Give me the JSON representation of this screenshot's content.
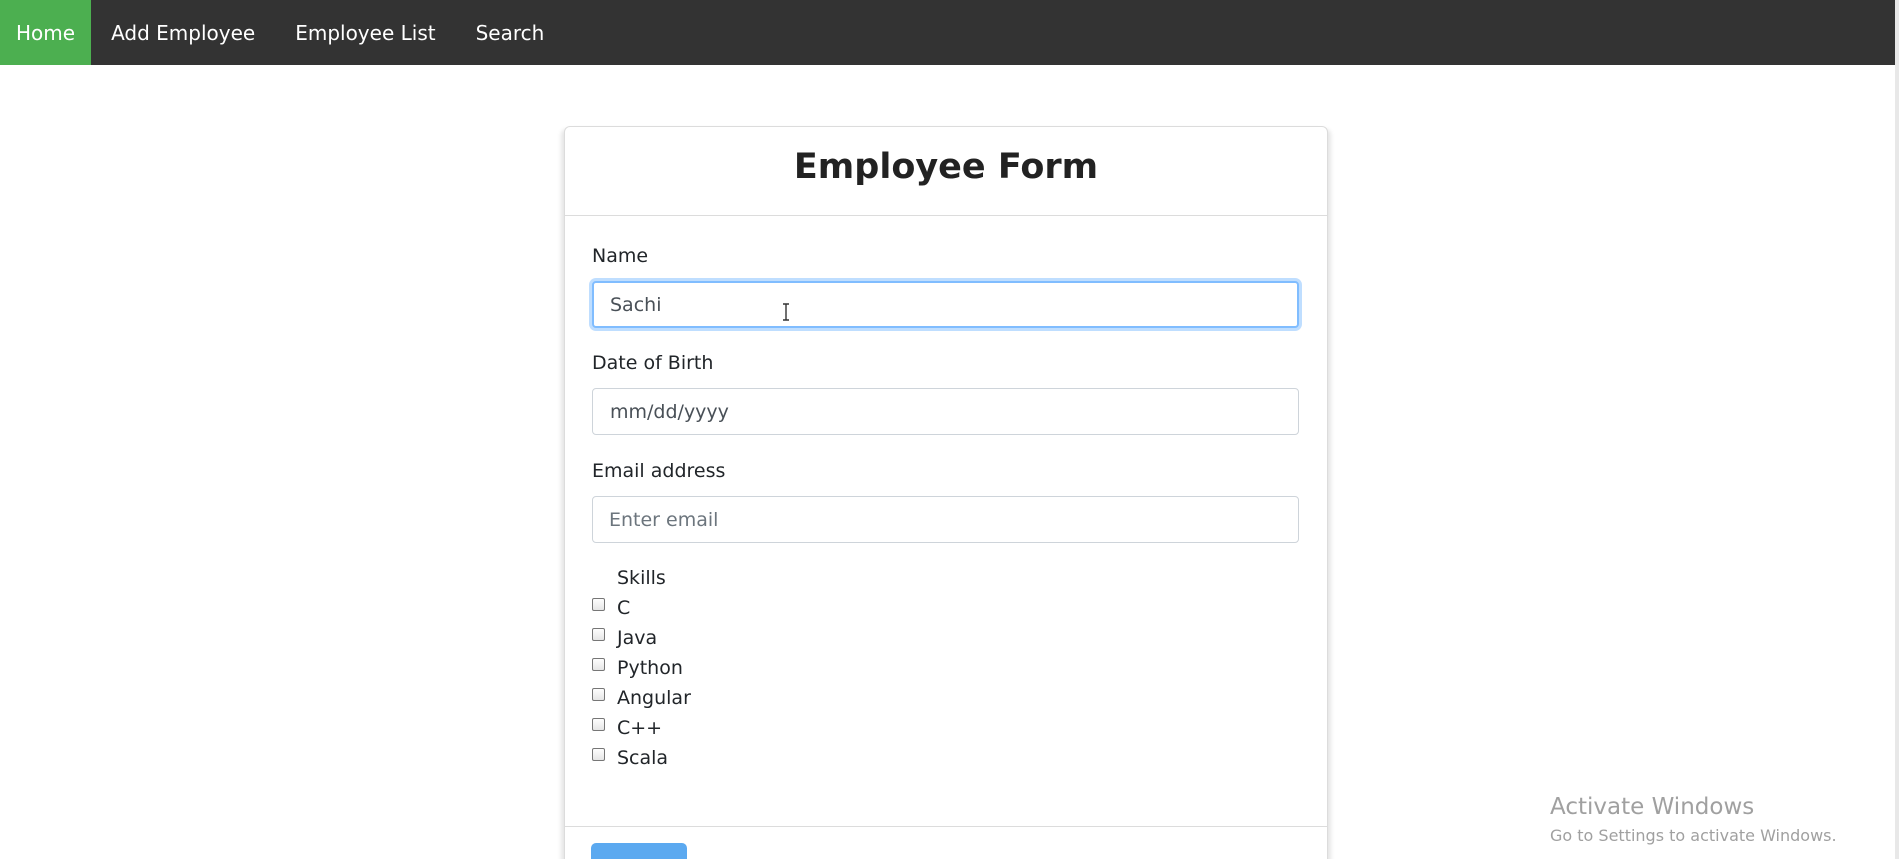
{
  "navbar": {
    "items": [
      {
        "label": "Home",
        "active": true
      },
      {
        "label": "Add Employee",
        "active": false
      },
      {
        "label": "Employee List",
        "active": false
      },
      {
        "label": "Search",
        "active": false
      }
    ]
  },
  "form": {
    "title": "Employee Form",
    "name": {
      "label": "Name",
      "value": "Sachi"
    },
    "dob": {
      "label": "Date of Birth",
      "placeholder": "mm/dd/yyyy"
    },
    "email": {
      "label": "Email address",
      "placeholder": "Enter email"
    },
    "skills": {
      "legend": "Skills",
      "options": [
        "C",
        "Java",
        "Python",
        "Angular",
        "C++",
        "Scala"
      ]
    }
  },
  "watermark": {
    "title": "Activate Windows",
    "subtitle": "Go to Settings to activate Windows."
  },
  "colors": {
    "navbar_bg": "#333333",
    "active_nav": "#4CAF50",
    "focus_border": "#80bdff",
    "submit_button": "#5ba9f0"
  },
  "icons": {
    "cursor": "text-cursor-icon"
  }
}
